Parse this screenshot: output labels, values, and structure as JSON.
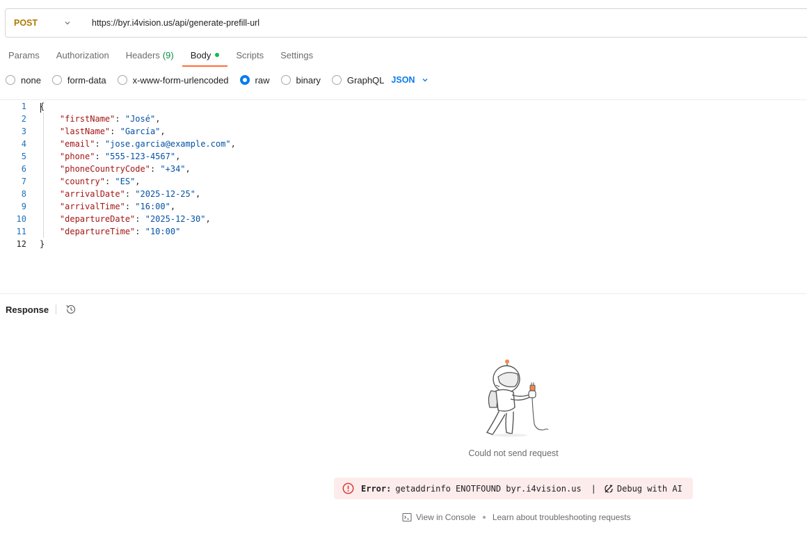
{
  "request": {
    "method": "POST",
    "url": "https://byr.i4vision.us/api/generate-prefill-url"
  },
  "tabs": [
    {
      "label": "Params"
    },
    {
      "label": "Authorization"
    },
    {
      "label": "Headers",
      "count": "(9)"
    },
    {
      "label": "Body",
      "active": true
    },
    {
      "label": "Scripts"
    },
    {
      "label": "Settings"
    }
  ],
  "body_types": {
    "options": [
      "none",
      "form-data",
      "x-www-form-urlencoded",
      "raw",
      "binary",
      "GraphQL"
    ],
    "selected": "raw",
    "language": "JSON"
  },
  "editor": {
    "lines": [
      {
        "n": "1",
        "text": "{"
      },
      {
        "n": "2",
        "key": "\"firstName\"",
        "value": "\"José\"",
        "comma": ","
      },
      {
        "n": "3",
        "key": "\"lastName\"",
        "value": "\"García\"",
        "comma": ","
      },
      {
        "n": "4",
        "key": "\"email\"",
        "value": "\"jose.garcia@example.com\"",
        "comma": ","
      },
      {
        "n": "5",
        "key": "\"phone\"",
        "value": "\"555-123-4567\"",
        "comma": ","
      },
      {
        "n": "6",
        "key": "\"phoneCountryCode\"",
        "value": "\"+34\"",
        "comma": ","
      },
      {
        "n": "7",
        "key": "\"country\"",
        "value": "\"ES\"",
        "comma": ","
      },
      {
        "n": "8",
        "key": "\"arrivalDate\"",
        "value": "\"2025-12-25\"",
        "comma": ","
      },
      {
        "n": "9",
        "key": "\"arrivalTime\"",
        "value": "\"16:00\"",
        "comma": ","
      },
      {
        "n": "10",
        "key": "\"departureDate\"",
        "value": "\"2025-12-30\"",
        "comma": ","
      },
      {
        "n": "11",
        "key": "\"departureTime\"",
        "value": "\"10:00\"",
        "comma": ""
      },
      {
        "n": "12",
        "text": "}"
      }
    ]
  },
  "response": {
    "title": "Response",
    "status_message": "Could not send request",
    "error_label": "Error:",
    "error_text": "getaddrinfo ENOTFOUND byr.i4vision.us",
    "separator": "|",
    "debug_label": "Debug with AI",
    "view_console": "View in Console",
    "troubleshoot": "Learn about troubleshooting requests"
  },
  "colors": {
    "method": "#ad7a03",
    "active_tab_underline": "#ff6c37",
    "accent_blue": "#097bed",
    "error_bg": "#fdecec",
    "error_icon": "#d93025"
  }
}
